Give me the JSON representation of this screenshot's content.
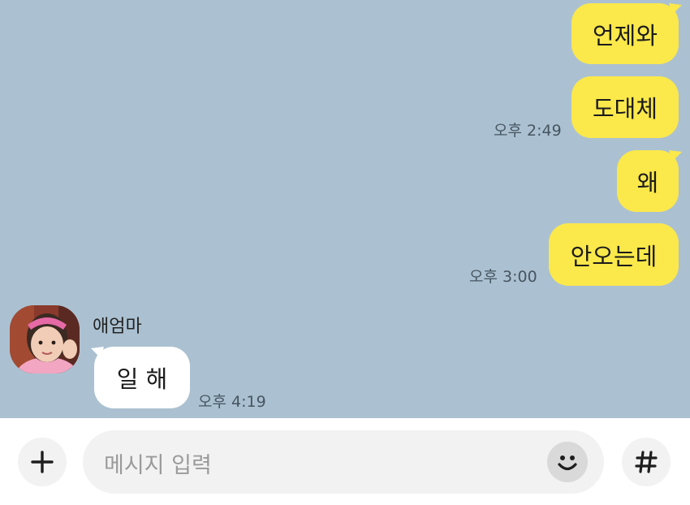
{
  "colors": {
    "chat_background": "#abc1d1",
    "my_bubble": "#fbe84b",
    "other_bubble": "#ffffff",
    "composer_background": "#ffffff"
  },
  "messages": {
    "sent": [
      {
        "text": "언제와"
      },
      {
        "text": "도대체",
        "time": "오후 2:49"
      },
      {
        "text": "왜"
      },
      {
        "text": "안오는데",
        "time": "오후 3:00"
      }
    ],
    "received": {
      "sender": "애엄마",
      "text": "일 해",
      "time": "오후 4:19"
    }
  },
  "composer": {
    "add_icon": "plus-icon",
    "placeholder": "메시지 입력",
    "emoji_icon": "smiley-icon",
    "hashtag_icon": "hashtag-icon"
  }
}
